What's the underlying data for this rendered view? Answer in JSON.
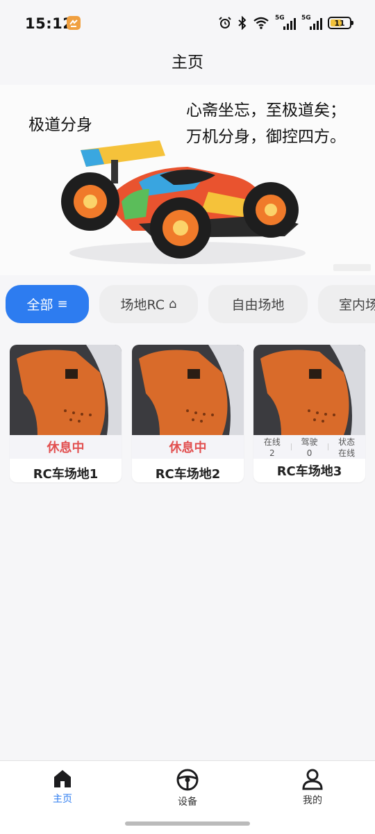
{
  "status_bar": {
    "time": "15:12",
    "network_5g_1": "5G",
    "network_5g_2": "5G",
    "battery_level": "11",
    "icons": [
      "alarm-icon",
      "bluetooth-icon",
      "wifi-icon",
      "signal-icon",
      "signal-icon",
      "battery-icon"
    ]
  },
  "header": {
    "title": "主页"
  },
  "banner": {
    "left_text": "极道分身",
    "right_line1": "心斋坐忘，至极道矣；",
    "right_line2": "万机分身，御控四方。"
  },
  "categories": [
    {
      "label": "全部",
      "icon": "menu-icon",
      "icon_glyph": "≡",
      "active": true
    },
    {
      "label": "场地RC",
      "icon": "home-icon",
      "icon_glyph": "⌂",
      "active": false
    },
    {
      "label": "自由场地",
      "active": false
    },
    {
      "label": "室内场",
      "active": false
    }
  ],
  "venues": [
    {
      "name": "RC车场地1",
      "status": "休息中"
    },
    {
      "name": "RC车场地2",
      "status": "休息中"
    },
    {
      "name": "RC车场地3",
      "stats": [
        {
          "label": "在线",
          "value": "2"
        },
        {
          "label": "驾驶",
          "value": "0"
        },
        {
          "label": "状态",
          "value": "在线"
        }
      ]
    }
  ],
  "bottom_nav": [
    {
      "label": "主页",
      "icon": "home-icon",
      "active": true
    },
    {
      "label": "设备",
      "icon": "steering-wheel-icon",
      "active": false
    },
    {
      "label": "我的",
      "icon": "user-icon",
      "active": false
    }
  ],
  "colors": {
    "accent": "#2d7cf0",
    "status_rest": "#e25050",
    "app_badge": "#f0a040"
  }
}
